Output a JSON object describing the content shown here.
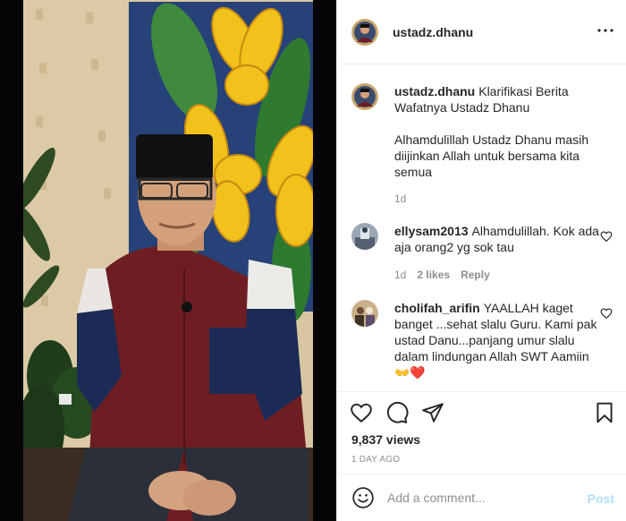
{
  "post": {
    "username": "ustadz.dhanu",
    "caption_line": "Klarifikasi Berita Wafatnya Ustadz Dhanu",
    "caption_body": "Alhamdulillah Ustadz Dhanu masih diijinkan Allah untuk bersama kita semua",
    "caption_age": "1d"
  },
  "comments": [
    {
      "username": "ellysam2013",
      "text": "Alhamdulillah. Kok ada aja orang2 yg sok tau",
      "age": "1d",
      "likes": "2 likes",
      "reply": "Reply"
    },
    {
      "username": "cholifah_arifin",
      "text": "YAALLAH kaget banget ...sehat slalu Guru. Kami pak ustad Danu...panjang umur slalu dalam lindungan Allah SWT Aamiin",
      "emoji": "👐❤️"
    }
  ],
  "stats": {
    "views": "9,837 views",
    "time": "1 DAY AGO"
  },
  "composer": {
    "placeholder": "Add a comment...",
    "post_label": "Post"
  },
  "icons": {
    "more": "more-options-icon",
    "heart": "heart-icon",
    "comment": "comment-icon",
    "share": "share-icon",
    "bookmark": "bookmark-icon",
    "emoji": "emoji-icon"
  },
  "colors": {
    "link_disabled": "#b2dffc",
    "muted": "#8e8e8e",
    "text": "#262626"
  }
}
